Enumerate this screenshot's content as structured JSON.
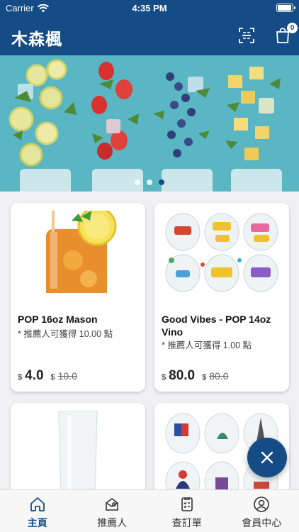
{
  "status_bar": {
    "carrier": "Carrier",
    "time": "4:35 PM"
  },
  "header": {
    "title": "木森楓",
    "scan_icon": "qr-scan-icon",
    "cart_icon": "shopping-bag-icon",
    "cart_count": "0"
  },
  "colors": {
    "brand": "#154c86",
    "background": "#f1f1f3",
    "card": "#ffffff"
  },
  "banner": {
    "slide_count": 3,
    "active_index": 2
  },
  "products": [
    {
      "name": "POP 16oz Mason",
      "reward": "* 推薦人可獲得 10.00 點",
      "currency": "$",
      "price": "4.0",
      "original_price": "10.0"
    },
    {
      "name": "Good Vibes - POP 14oz Vino",
      "reward": "* 推薦人可獲得 1.00 點",
      "currency": "$",
      "price": "80.0",
      "original_price": "80.0"
    },
    {
      "image": "clear-glass-flute"
    },
    {
      "image": "city-print-glasses"
    }
  ],
  "fab": {
    "icon": "close-icon"
  },
  "tabs": [
    {
      "label": "主頁",
      "icon": "home-icon",
      "active": true
    },
    {
      "label": "推薦人",
      "icon": "referral-icon",
      "active": false
    },
    {
      "label": "查訂單",
      "icon": "order-list-icon",
      "active": false
    },
    {
      "label": "會員中心",
      "icon": "user-icon",
      "active": false
    }
  ]
}
